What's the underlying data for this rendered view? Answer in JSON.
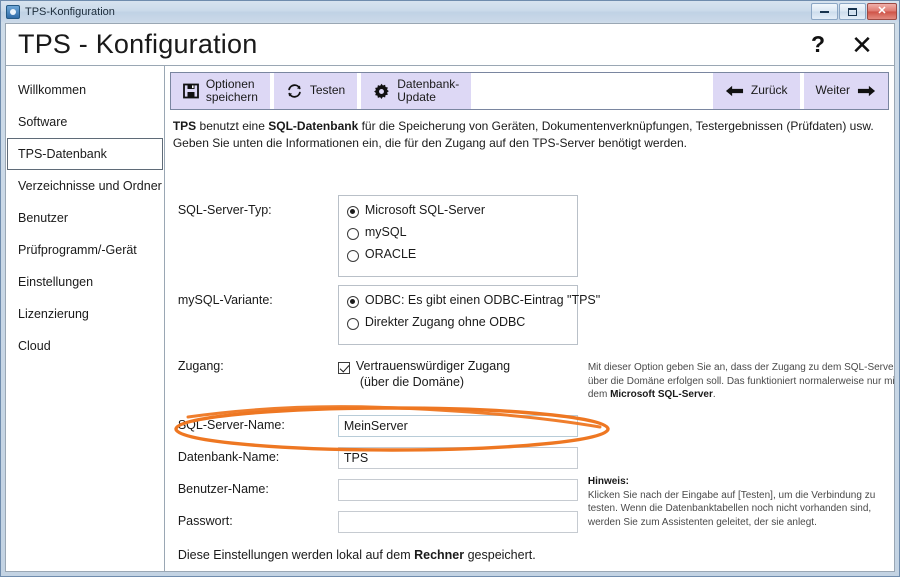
{
  "window": {
    "title": "TPS-Konfiguration",
    "icon": "app-icon",
    "controls": {
      "minimize": "minimize-button",
      "maximize": "maximize-button",
      "close": "close-button",
      "close_glyph": "✕"
    }
  },
  "header": {
    "title": "TPS - Konfiguration",
    "help_glyph": "?",
    "close_glyph": "✕"
  },
  "sidebar": {
    "items": [
      {
        "label": "Willkommen",
        "selected": false
      },
      {
        "label": "Software",
        "selected": false
      },
      {
        "label": "TPS-Datenbank",
        "selected": true
      },
      {
        "label": "Verzeichnisse und Ordner",
        "selected": false
      },
      {
        "label": "Benutzer",
        "selected": false
      },
      {
        "label": "Prüfprogramm/-Gerät",
        "selected": false
      },
      {
        "label": "Einstellungen",
        "selected": false
      },
      {
        "label": "Lizenzierung",
        "selected": false
      },
      {
        "label": "Cloud",
        "selected": false
      }
    ]
  },
  "toolbar": {
    "save_label": "Optionen\nspeichern",
    "save_icon": "floppy-disk-icon",
    "test_label": "Testen",
    "test_icon": "refresh-icon",
    "dbupdate_label": "Datenbank-\nUpdate",
    "dbupdate_icon": "gear-icon",
    "back_label": "Zurück",
    "back_icon": "arrow-left-icon",
    "next_label": "Weiter",
    "next_icon": "arrow-right-icon",
    "button_bg": "#ddd8f5"
  },
  "description": {
    "part1": "TPS",
    "part2": " benutzt eine ",
    "part3": "SQL-Datenbank",
    "part4": " für die Speicherung von Geräten, Dokumentenverknüpfungen, Testergebnissen (Prüfdaten) usw. Geben Sie unten die Informationen ein, die für den Zugang auf den TPS-Server benötigt werden."
  },
  "form": {
    "server_type": {
      "label": "SQL-Server-Typ:",
      "options": [
        {
          "label": "Microsoft SQL-Server",
          "selected": true
        },
        {
          "label": "mySQL",
          "selected": false
        },
        {
          "label": "ORACLE",
          "selected": false
        }
      ]
    },
    "mysql_variant": {
      "label": "mySQL-Variante:",
      "options": [
        {
          "label": "ODBC: Es gibt einen ODBC-Eintrag \"TPS\"",
          "selected": true
        },
        {
          "label": "Direkter Zugang ohne ODBC",
          "selected": false
        }
      ]
    },
    "access": {
      "label": "Zugang:",
      "checkbox_label_line1": "Vertrauenswürdiger Zugang",
      "checkbox_label_line2": "(über die Domäne)",
      "checked": true
    },
    "server_name": {
      "label": "SQL-Server-Name:",
      "value": "MeinServer",
      "placeholder": ""
    },
    "db_name": {
      "label": "Datenbank-Name:",
      "value": "TPS",
      "placeholder": ""
    },
    "user_name": {
      "label": "Benutzer-Name:",
      "value": "",
      "placeholder": ""
    },
    "password": {
      "label": "Passwort:",
      "value": "",
      "placeholder": ""
    }
  },
  "hints": {
    "trusted": {
      "text1": "Mit dieser Option geben Sie an, dass der Zugang zu dem SQL-Server über die Domäne erfolgen soll. Das funktioniert normalerweise nur mit dem ",
      "bold": "Microsoft SQL-Server",
      "text2": "."
    },
    "note": {
      "title": "Hinweis:",
      "body": "Klicken Sie nach der Eingabe auf [Testen], um die Verbindung zu testen. Wenn die Datenbanktabellen noch nicht vorhanden sind, werden Sie zum Assistenten geleitet, der sie anlegt."
    }
  },
  "footer": {
    "text1": "Diese Einstellungen werden lokal auf dem ",
    "bold": "Rechner",
    "text2": " gespeichert."
  },
  "annotation": {
    "shape": "ellipse-highlight",
    "color": "#ee7722"
  }
}
